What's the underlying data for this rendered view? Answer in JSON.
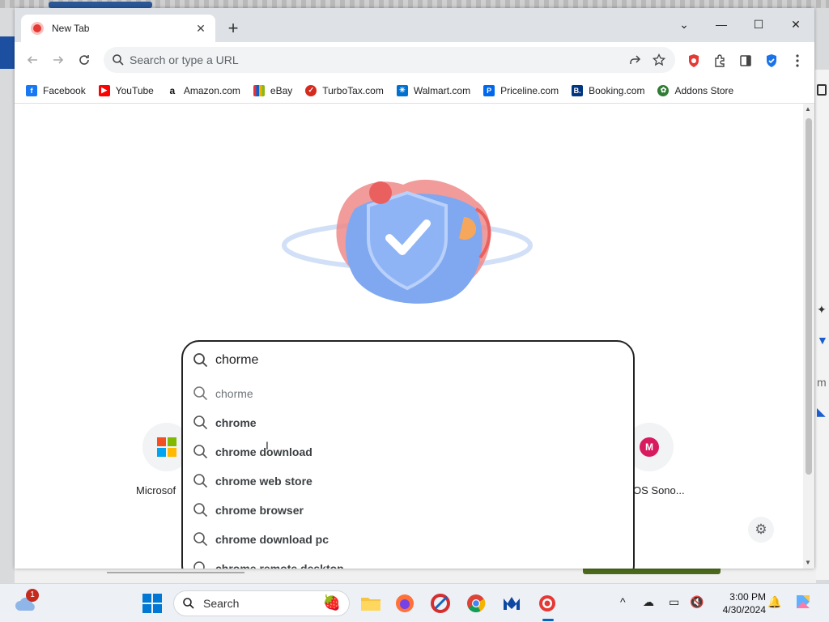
{
  "browser": {
    "tab_title": "New Tab",
    "close_tab_glyph": "✕",
    "new_tab_glyph": "+",
    "minimize_glyph": "—",
    "maximize_glyph": "☐",
    "close_glyph": "✕",
    "dropdown_glyph": "⌄"
  },
  "omnibox": {
    "placeholder": "Search or type a URL"
  },
  "bookmarks": [
    {
      "label": "Facebook",
      "icon": "facebook-icon",
      "color": "#1877f2",
      "glyph": "f"
    },
    {
      "label": "YouTube",
      "icon": "youtube-icon",
      "color": "#ff0000",
      "glyph": "▶"
    },
    {
      "label": "Amazon.com",
      "icon": "amazon-icon",
      "color": "#111111",
      "glyph": "a"
    },
    {
      "label": "eBay",
      "icon": "ebay-icon",
      "color": "#e53238",
      "glyph": "e"
    },
    {
      "label": "TurboTax.com",
      "icon": "turbotax-icon",
      "color": "#d52b1e",
      "glyph": "✓"
    },
    {
      "label": "Walmart.com",
      "icon": "walmart-icon",
      "color": "#0071ce",
      "glyph": "✳"
    },
    {
      "label": "Priceline.com",
      "icon": "priceline-icon",
      "color": "#0068ef",
      "glyph": "P"
    },
    {
      "label": "Booking.com",
      "icon": "booking-icon",
      "color": "#003580",
      "glyph": "B."
    },
    {
      "label": "Addons Store",
      "icon": "addons-store-icon",
      "color": "#2e7d32",
      "glyph": "✿"
    }
  ],
  "search": {
    "input_value": "chorme",
    "suggestions": [
      "chorme",
      "chrome",
      "chrome download",
      "chrome web store",
      "chrome browser",
      "chrome download pc",
      "chrome remote desktop"
    ]
  },
  "shortcuts": {
    "left_label": "Microsof",
    "right_label": "OS Sono...",
    "right_letter": "M"
  },
  "taskbar": {
    "search_label": "Search",
    "weather_badge": "1",
    "time": "3:00 PM",
    "date": "4/30/2024",
    "chevron": "^"
  },
  "colors": {
    "accent": "#1a73e8",
    "tab_bar": "#dee1e6",
    "shield_red": "#e53935",
    "taskbar_active": "#0067c0"
  }
}
